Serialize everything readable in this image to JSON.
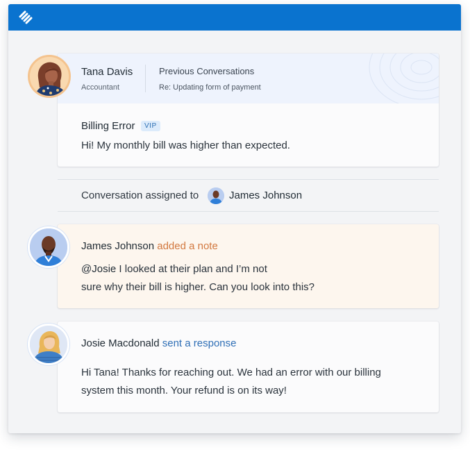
{
  "app": {
    "brand_color": "#0a73cf",
    "logo_icon": "help-scout-logo-icon"
  },
  "customer_card": {
    "customer": {
      "name": "Tana Davis",
      "role": "Accountant",
      "avatar_icon": "tana-davis-avatar"
    },
    "previous_conversations": {
      "title": "Previous Conversations",
      "item": "Re: Updating form of payment"
    },
    "ticket": {
      "subject": "Billing Error",
      "badge": "VIP",
      "message": "Hi! My monthly bill was higher than expected."
    }
  },
  "assignment": {
    "prefix": "Conversation assigned to",
    "assignee": "James Johnson"
  },
  "note": {
    "author": "James Johnson",
    "action": "added a note",
    "mention": "@Josie",
    "line1_rest": " I looked at their plan and I’m not",
    "line2": "sure why their bill is higher. Can you look into this?",
    "background": "#fdf6ee"
  },
  "response": {
    "author": "Josie Macdonald",
    "action": "sent a response",
    "line1": "Hi Tana! Thanks for reaching out. We had an error with our billing",
    "line2": "system this month. Your refund is on its way!"
  }
}
